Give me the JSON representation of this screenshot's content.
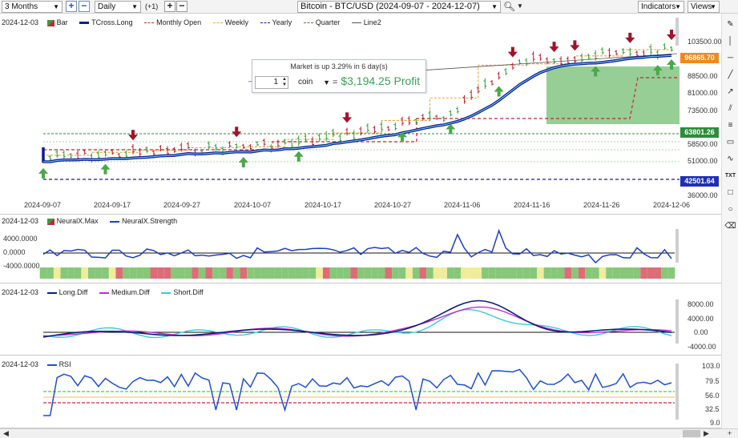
{
  "toolbar": {
    "range": "3 Months",
    "interval": "Daily",
    "offset": "(+1)",
    "symbol_title": "Bitcoin - BTC/USD (2024-09-07 - 2024-12-07)",
    "indicators_label": "Indicators",
    "views_label": "Views"
  },
  "colors": {
    "up_arrow": "#4aa84a",
    "down_arrow": "#a3122a",
    "tcross_long": "#0a1f8f",
    "monthly_open": "#d21f2f",
    "weekly": "#f2a23a",
    "yearly": "#1a1aa8",
    "quarter": "#3b8b3b",
    "line2": "#555555",
    "profit_fill": "#73bd73",
    "neural_max_green": "#86c878",
    "neural_max_red": "#de6c78",
    "neural_max_yellow": "#f1ec9a",
    "neural_strength": "#1f3fbf",
    "long_diff": "#0b1f7a",
    "medium_diff": "#c12fcf",
    "short_diff": "#3fc9dd",
    "rsi": "#1f4fd1"
  },
  "price_pane": {
    "date": "2024-12-03",
    "legend": [
      "Bar",
      "TCross.Long",
      "Monthly Open",
      "Weekly",
      "Yearly",
      "Quarter",
      "Line2"
    ],
    "y_ticks": [
      "103500.00",
      "88500.00",
      "81000.00",
      "73500.00",
      "58500.00",
      "51000.00",
      "36000.00"
    ],
    "tags": {
      "last_price": "96865.70",
      "quarter_level": "63801.26",
      "yearly_level": "42501.64"
    },
    "x_ticks": [
      "2024-09-07",
      "2024-09-17",
      "2024-09-27",
      "2024-10-07",
      "2024-10-17",
      "2024-10-27",
      "2024-11-06",
      "2024-11-16",
      "2024-11-26",
      "2024-12-06"
    ]
  },
  "info_box": {
    "header": "Market is up 3.29% in 6 day(s)",
    "quantity": "1",
    "unit": "coin",
    "equals": "=",
    "profit": "$3,194.25 Profit"
  },
  "neural_pane": {
    "date": "2024-12-03",
    "legend": [
      "NeuralX.Max",
      "NeuralX.Strength"
    ],
    "y_ticks": [
      "4000.0000",
      "0.0000",
      "-4000.0000"
    ]
  },
  "diff_pane": {
    "date": "2024-12-03",
    "legend": [
      "Long.Diff",
      "Medium.Diff",
      "Short.Diff"
    ],
    "y_ticks": [
      "8000.00",
      "4000.00",
      "0.00",
      "-4000.00"
    ]
  },
  "rsi_pane": {
    "date": "2024-12-03",
    "legend": [
      "RSI"
    ],
    "y_ticks": [
      "103.0",
      "79.5",
      "56.0",
      "32.5",
      "9.0"
    ]
  }
}
